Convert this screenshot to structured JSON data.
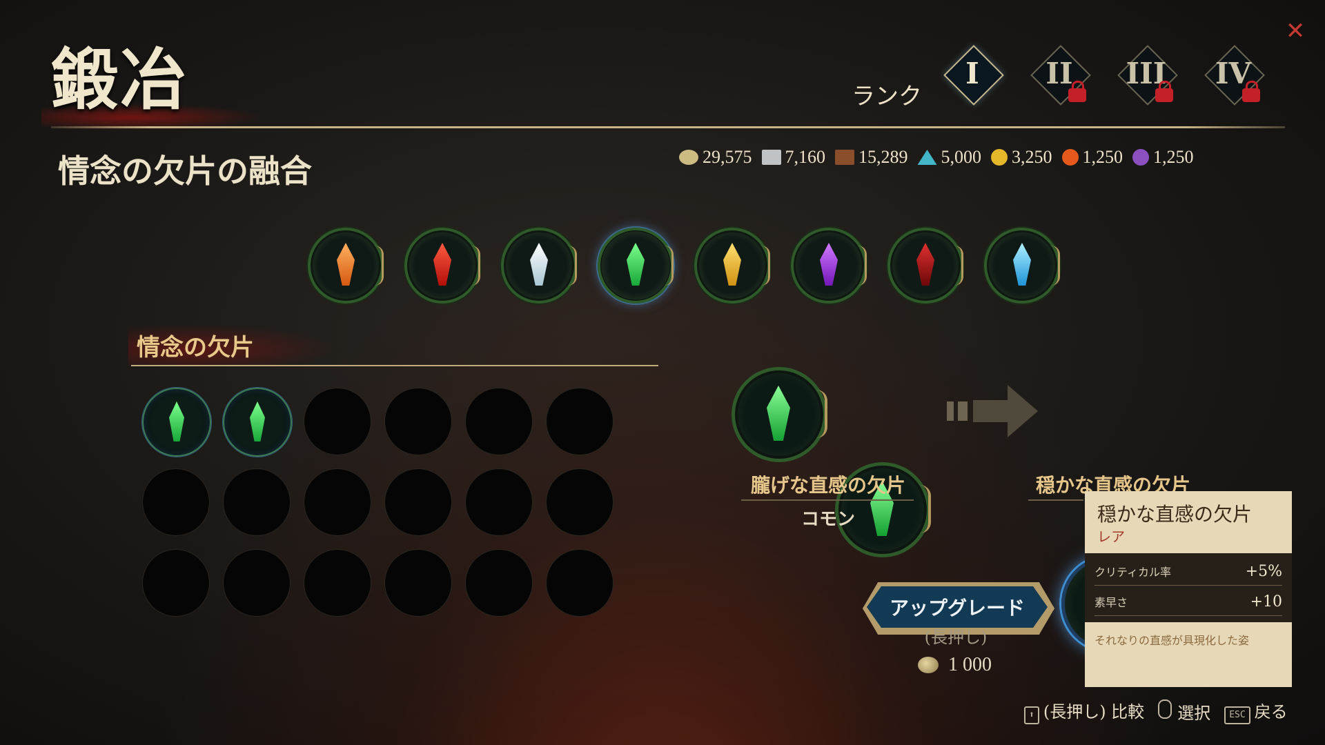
{
  "header": {
    "title": "鍛冶",
    "rank_label": "ランク",
    "ranks": [
      {
        "label": "I",
        "locked": false
      },
      {
        "label": "II",
        "locked": true
      },
      {
        "label": "III",
        "locked": true
      },
      {
        "label": "IV",
        "locked": true
      }
    ],
    "close_icon": "close-x-icon"
  },
  "subtitle": "情念の欠片の融合",
  "currencies": [
    {
      "icon": "gold-coins-icon",
      "value": "29,575",
      "color": "#cdbb84"
    },
    {
      "icon": "iron-ingot-icon",
      "value": "7,160",
      "color": "#bfc3c6"
    },
    {
      "icon": "wood-planks-icon",
      "value": "15,289",
      "color": "#8a4f2a"
    },
    {
      "icon": "crystal-icon",
      "value": "5,000",
      "color": "#43b7c8"
    },
    {
      "icon": "gold-medal-icon",
      "value": "3,250",
      "color": "#e4b62a"
    },
    {
      "icon": "orange-gem-icon",
      "value": "1,250",
      "color": "#e5591d"
    },
    {
      "icon": "purple-skull-icon",
      "value": "1,250",
      "color": "#8c4fbf"
    }
  ],
  "shard_types": [
    {
      "color": "#f07f1f",
      "selected": false
    },
    {
      "color": "#e0251a",
      "selected": false
    },
    {
      "color": "#e6f2f6",
      "selected": false
    },
    {
      "color": "#2ad049",
      "selected": true
    },
    {
      "color": "#f2c42a",
      "selected": false
    },
    {
      "color": "#a43be0",
      "selected": false
    },
    {
      "color": "#b51919",
      "selected": false
    },
    {
      "color": "#56c4f2",
      "selected": false
    }
  ],
  "inventory": {
    "heading": "情念の欠片",
    "slots": [
      true,
      true,
      false,
      false,
      false,
      false,
      false,
      false,
      false,
      false,
      false,
      false,
      false,
      false,
      false,
      false,
      false,
      false
    ]
  },
  "fusion": {
    "input_name": "朧げな直感の欠片",
    "input_rarity": "コモン",
    "output_name": "穏かな直感の欠片"
  },
  "tooltip": {
    "title": "穏かな直感の欠片",
    "rarity": "レア",
    "stats": [
      {
        "label": "クリティカル率",
        "value": "+5%"
      },
      {
        "label": "素早さ",
        "value": "+10"
      }
    ],
    "description": "それなりの直感が具現化した姿"
  },
  "upgrade": {
    "label": "アップグレード",
    "hold": "(長押し)",
    "cost": "1 000"
  },
  "hints": {
    "compare": "(長押し) 比較",
    "select": "選択",
    "back": "戻る",
    "esc_key": "ESC",
    "up_key": "⬆"
  }
}
